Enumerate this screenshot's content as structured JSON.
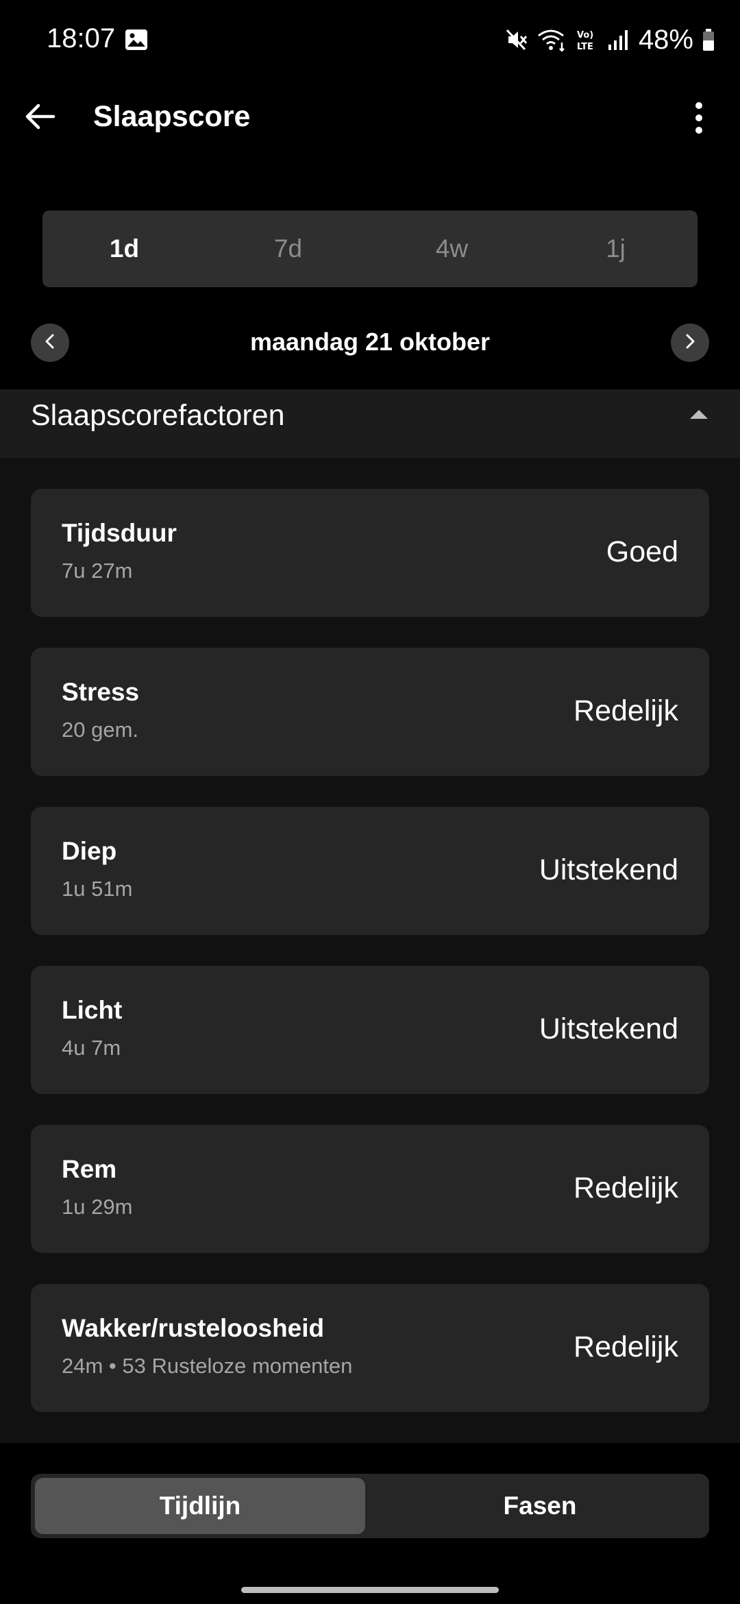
{
  "status_bar": {
    "time": "18:07",
    "battery": "48%",
    "icons": [
      "gallery-icon",
      "mute-icon",
      "wifi-icon",
      "volte-icon",
      "signal-icon",
      "battery-icon"
    ]
  },
  "app_bar": {
    "title": "Slaapscore",
    "back_icon": "arrow-left-icon",
    "more_icon": "more-vertical-icon"
  },
  "range_tabs": {
    "items": [
      {
        "label": "1d",
        "active": true
      },
      {
        "label": "7d",
        "active": false
      },
      {
        "label": "4w",
        "active": false
      },
      {
        "label": "1j",
        "active": false
      }
    ]
  },
  "date_nav": {
    "date": "maandag 21 oktober"
  },
  "section": {
    "title": "Slaapscorefactoren",
    "expanded": true
  },
  "factors": [
    {
      "name": "Tijdsduur",
      "value": "7u 27m",
      "rating": "Goed"
    },
    {
      "name": "Stress",
      "value": "20 gem.",
      "rating": "Redelijk"
    },
    {
      "name": "Diep",
      "value": "1u 51m",
      "rating": "Uitstekend"
    },
    {
      "name": "Licht",
      "value": "4u 7m",
      "rating": "Uitstekend"
    },
    {
      "name": "Rem",
      "value": "1u 29m",
      "rating": "Redelijk"
    },
    {
      "name": "Wakker/rusteloosheid",
      "value": "24m • 53 Rusteloze momenten",
      "rating": "Redelijk"
    }
  ],
  "bottom_tabs": {
    "left": {
      "label": "Tijdlijn",
      "active": true
    },
    "right": {
      "label": "Fasen",
      "active": false
    }
  },
  "colors": {
    "background": "#000000",
    "card": "#262626",
    "section_bg": "#1c1c1c",
    "tab_active": "#555555",
    "muted_text": "#a6a6a6"
  }
}
